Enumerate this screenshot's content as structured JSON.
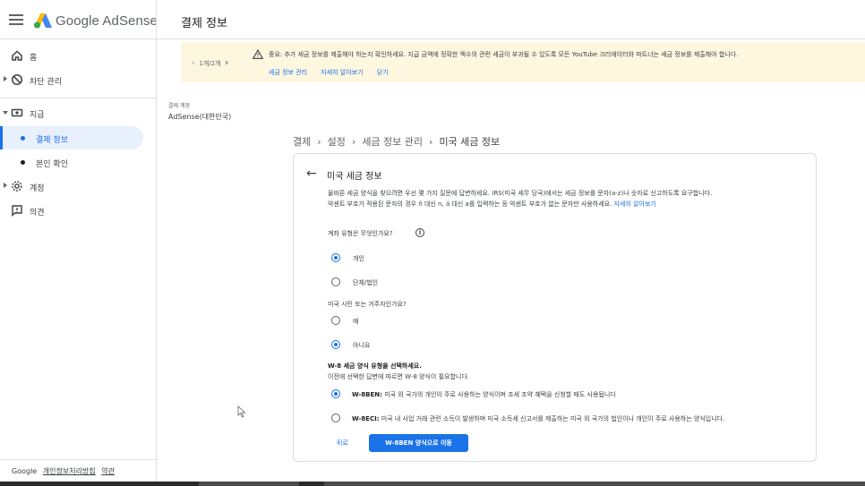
{
  "header": {
    "brand": "Google AdSense",
    "page_title": "결제 정보"
  },
  "sidebar": {
    "items": [
      {
        "label": "홈",
        "icon": "home-icon"
      },
      {
        "label": "차단 관리",
        "icon": "block-icon"
      },
      {
        "label": "지급",
        "icon": "payments-icon"
      },
      {
        "label": "결제 정보",
        "active": true
      },
      {
        "label": "본인 확인"
      },
      {
        "label": "계정",
        "icon": "gear-icon"
      },
      {
        "label": "의견",
        "icon": "feedback-icon"
      }
    ],
    "footer": {
      "google": "Google",
      "privacy": "개인정보처리방침",
      "terms": "약관"
    }
  },
  "banner": {
    "pager": "1개/2개",
    "message": "중요: 추가 세금 정보를 제출해야 하는지 확인하세요. 지급 금액에 정확한 액수의 관련 세금이 부과될 수 있도록 모든 YouTube 크리에이터와 파트너는 세금 정보를 제출해야 합니다.",
    "links": [
      "세금 정보 관리",
      "자세히 알아보기",
      "닫기"
    ]
  },
  "account": {
    "label": "결제 계정",
    "value": "AdSense(대한민국)"
  },
  "breadcrumb": [
    "결제",
    "설정",
    "세금 정보 관리",
    "미국 세금 정보"
  ],
  "card": {
    "title": "미국 세금 정보",
    "desc_line1": "올바른 세금 양식을 찾으려면 우선 몇 가지 질문에 답변하세요. IRS(미국 세무 당국)에서는 세금 정보를 문자(a-z)나 숫자로 신고하도록 요구합니다.",
    "desc_line2": "악센트 부호가 적용된 문자의 경우 ñ 대신 n, á 대신 a를 입력하는 등 악센트 부호가 없는 문자만 사용하세요.",
    "desc_link": "자세히 알아보기",
    "q1": "계좌 유형은 무엇인가요?",
    "q1_options": [
      {
        "label": "개인",
        "selected": true
      },
      {
        "label": "단체/법인",
        "selected": false
      }
    ],
    "q2": "미국 시민 또는 거주자인가요?",
    "q2_options": [
      {
        "label": "예",
        "selected": false
      },
      {
        "label": "아니요",
        "selected": true
      }
    ],
    "form_heading": "W-8 세금 양식 유형을 선택하세요.",
    "form_sub": "이전에 선택한 답변에 따르면 W-8 양식이 필요합니다.",
    "form_options": [
      {
        "code": "W-8BEN:",
        "text": " 미국 외 국가의 개인이 주로 사용하는 양식이며 조세 조약 혜택을 신청할 때도 사용됩니다",
        "selected": true
      },
      {
        "code": "W-8ECI:",
        "text": " 미국 내 사업 거래 관련 소득이 발생하며 미국 소득세 신고서를 제출하는 미국 외 국가의 법인이나 개인이 주로 사용하는 양식입니다.",
        "selected": false
      }
    ],
    "back_label": "뒤로",
    "primary_label": "W-8BEN 양식으로 이동"
  },
  "colors": {
    "accent": "#1a73e8",
    "banner_bg": "#fef7e0",
    "active_bg": "#e8f0fe"
  }
}
